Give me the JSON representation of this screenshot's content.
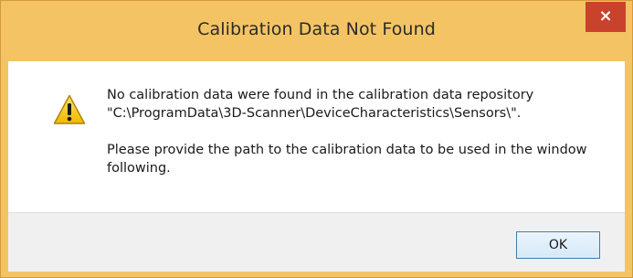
{
  "window": {
    "title": "Calibration Data Not Found",
    "close_glyph": "×"
  },
  "icon": "warning-icon",
  "message": {
    "line1": "No calibration data were found in the calibration data repository",
    "line2": "\"C:\\ProgramData\\3D-Scanner\\DeviceCharacteristics\\Sensors\\\".",
    "paragraph2": "Please provide the path to the calibration data to be used in the window following."
  },
  "buttons": {
    "ok": "OK"
  },
  "colors": {
    "titlebar": "#f4c464",
    "close_button": "#c9432c",
    "footer": "#f0f0f0",
    "button_border": "#3c7fb1"
  }
}
